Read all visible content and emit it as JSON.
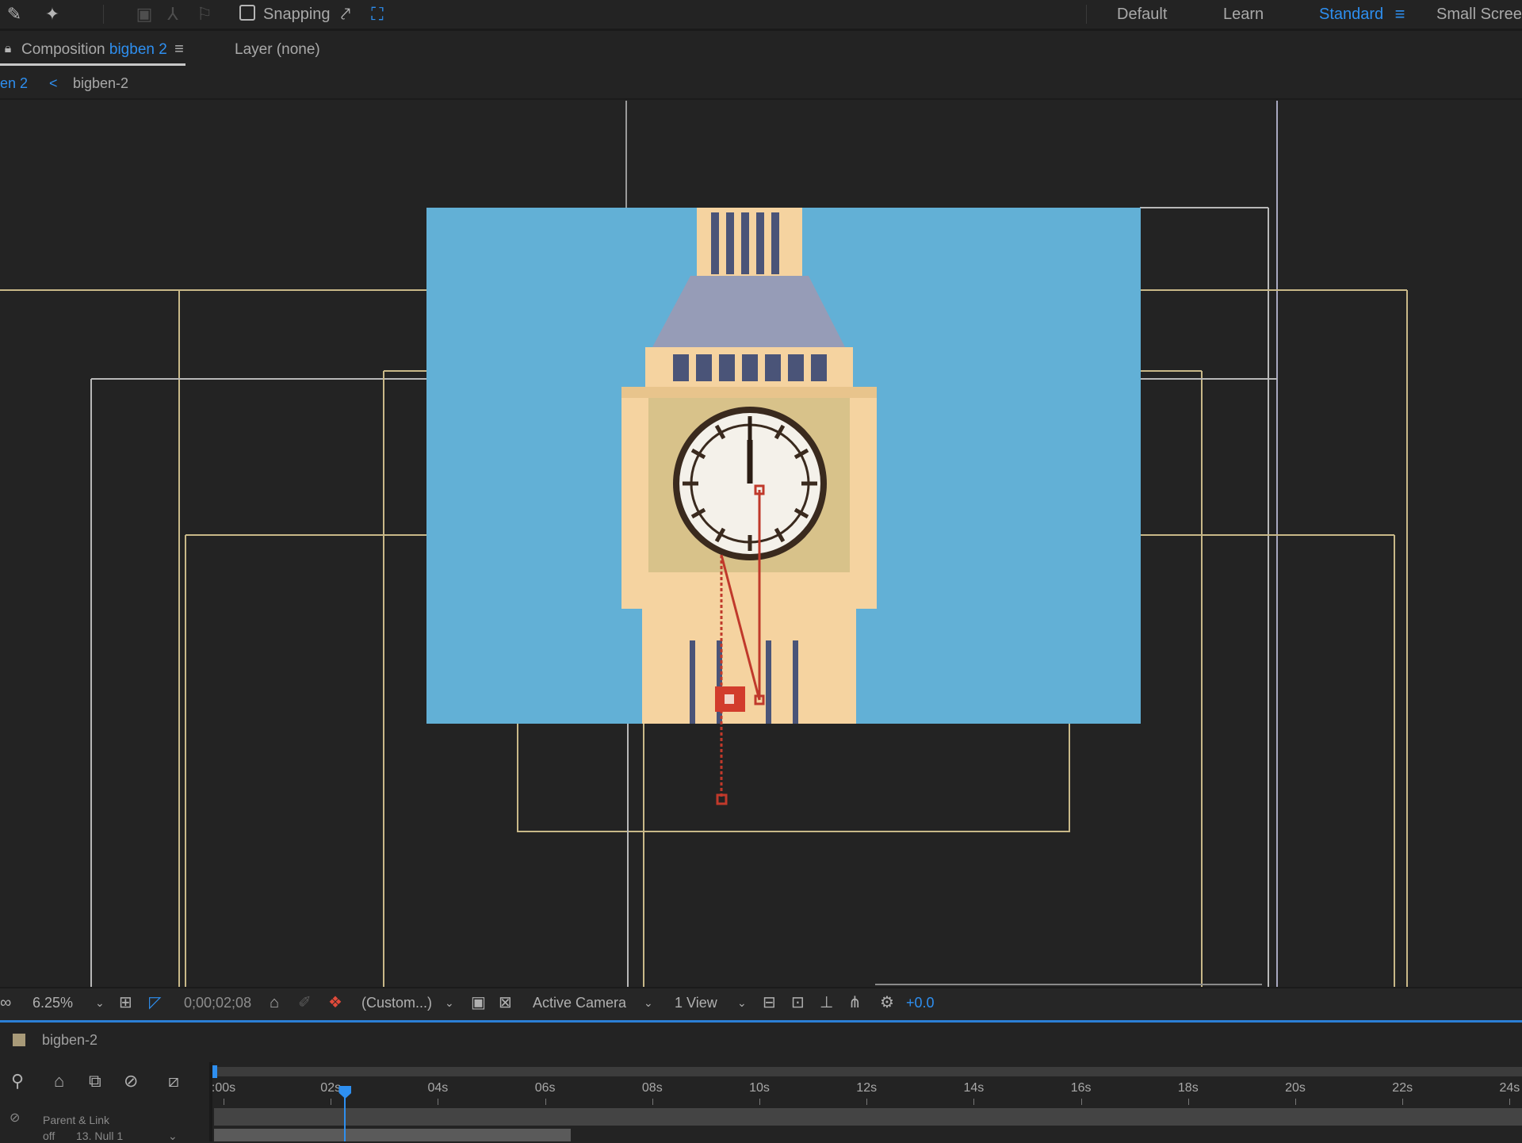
{
  "toolbar": {
    "snapping_label": "Snapping",
    "workspaces": [
      "Default",
      "Learn",
      "Standard",
      "Small Screen"
    ],
    "active_workspace": "Standard",
    "icons": [
      "puppet-pin-icon",
      "pin-icon",
      "snapping-checkbox",
      "snap-options-icon",
      "snap-grid-icon",
      "workspace-menu-icon"
    ]
  },
  "panels": {
    "composition_prefix": "Composition",
    "composition_name": "bigben 2",
    "layer_tab": "Layer  (none)",
    "breadcrumb_current": "en 2",
    "breadcrumb_chevron": "<",
    "breadcrumb_next": "bigben-2"
  },
  "viewer_bar": {
    "zoom": "6.25%",
    "timecode": "0;00;02;08",
    "resolution": "(Custom...)",
    "camera": "Active Camera",
    "view": "1 View",
    "exposure": "+0.0"
  },
  "timeline": {
    "comp_name": "bigben-2",
    "ticks": [
      ":00s",
      "02s",
      "04s",
      "06s",
      "08s",
      "10s",
      "12s",
      "14s",
      "16s",
      "18s",
      "20s",
      "22s",
      "24s"
    ],
    "playhead_seconds": 2.27,
    "column_header": "Parent & Link",
    "layer_row_mode": "off",
    "layer_row_name": "13. Null 1"
  },
  "colors": {
    "accent": "#2e8ff0",
    "sky": "#62b0d6",
    "tower": "#f5d3a0",
    "roof": "#969cb7",
    "window": "#4a5478",
    "rig": "#c0392b"
  }
}
